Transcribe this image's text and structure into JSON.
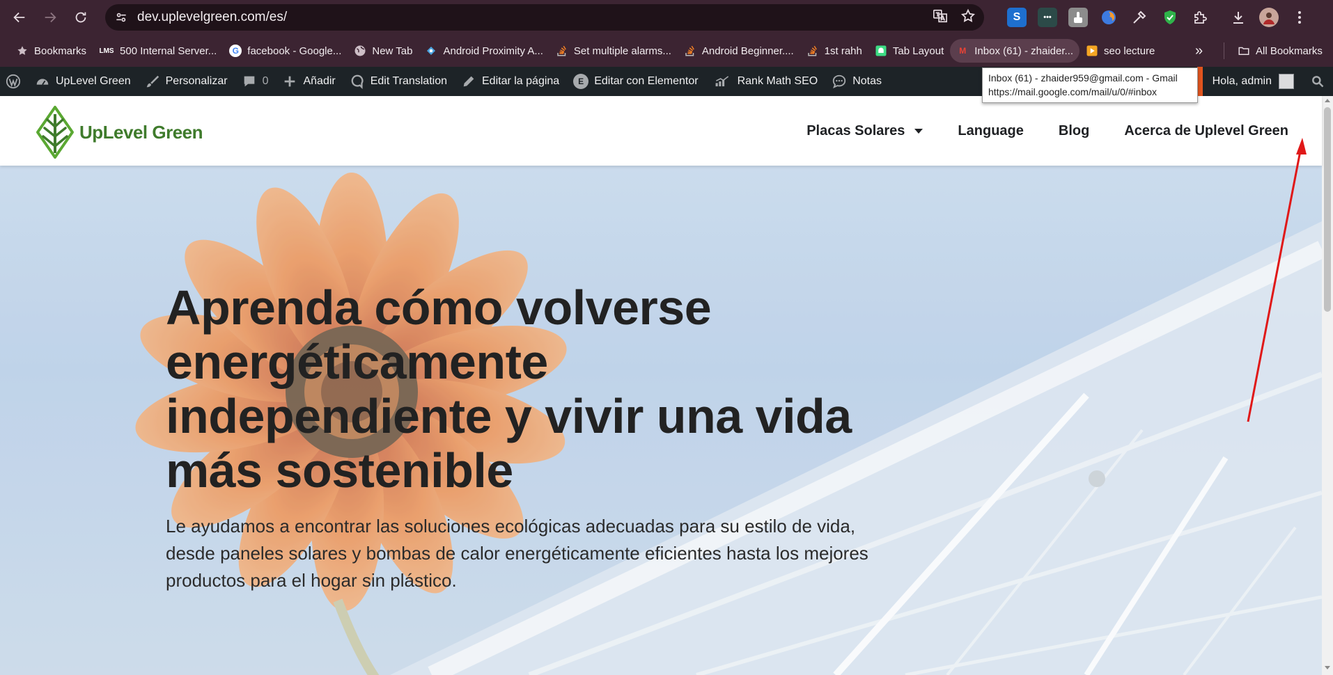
{
  "browser": {
    "url": "dev.uplevelgreen.com/es/",
    "extensions": [
      "S",
      "•••"
    ]
  },
  "bookmarks": {
    "items": [
      {
        "label": "Bookmarks",
        "icon": "star-icon"
      },
      {
        "label": "500 Internal Server...",
        "icon": "lms-icon",
        "badge": "LMS"
      },
      {
        "label": "facebook - Google...",
        "icon": "google-icon",
        "badge": "G"
      },
      {
        "label": "New Tab",
        "icon": "globe-icon"
      },
      {
        "label": "Android Proximity A...",
        "icon": "android-icon"
      },
      {
        "label": "Set multiple alarms...",
        "icon": "stackoverflow-icon"
      },
      {
        "label": "Android Beginner....",
        "icon": "stackoverflow-icon"
      },
      {
        "label": "1st rahh",
        "icon": "stackoverflow-icon"
      },
      {
        "label": "Tab Layout",
        "icon": "android-icon"
      },
      {
        "label": "Inbox (61) - zhaider...",
        "icon": "gmail-icon",
        "badge": "M"
      },
      {
        "label": "seo lecture",
        "icon": "play-icon"
      }
    ],
    "more": "»",
    "all_label": "All Bookmarks"
  },
  "adminbar": {
    "site_name": "UpLevel Green",
    "customize": "Personalizar",
    "comments_count": "0",
    "add_new": "Añadir",
    "edit_translation": "Edit Translation",
    "edit_page": "Editar la página",
    "edit_elementor": "Editar con Elementor",
    "elementor_badge": "E",
    "rank_math": "Rank Math SEO",
    "notes": "Notas",
    "greeting": "Hola, admin"
  },
  "tooltip": {
    "line1": "Inbox (61) - zhaider959@gmail.com - Gmail",
    "line2": "https://mail.google.com/mail/u/0/#inbox"
  },
  "site": {
    "logo_text": "UpLevel Green",
    "nav": [
      "Placas Solares",
      "Language",
      "Blog",
      "Acerca de Uplevel Green"
    ]
  },
  "hero": {
    "title": "Aprenda cómo volverse energéticamente independiente y vivir una vida más sostenible",
    "subtitle": "Le ayudamos a encontrar las soluciones ecológicas adecuadas para su estilo de vida, desde paneles solares y bombas de calor energéticamente eficientes hasta los mejores productos para el hogar sin plástico."
  },
  "colors": {
    "brand_green": "#3f7b2c",
    "admin_bar": "#1d2327",
    "browser_frame": "#3c2432",
    "annotation_arrow": "#e01818"
  }
}
